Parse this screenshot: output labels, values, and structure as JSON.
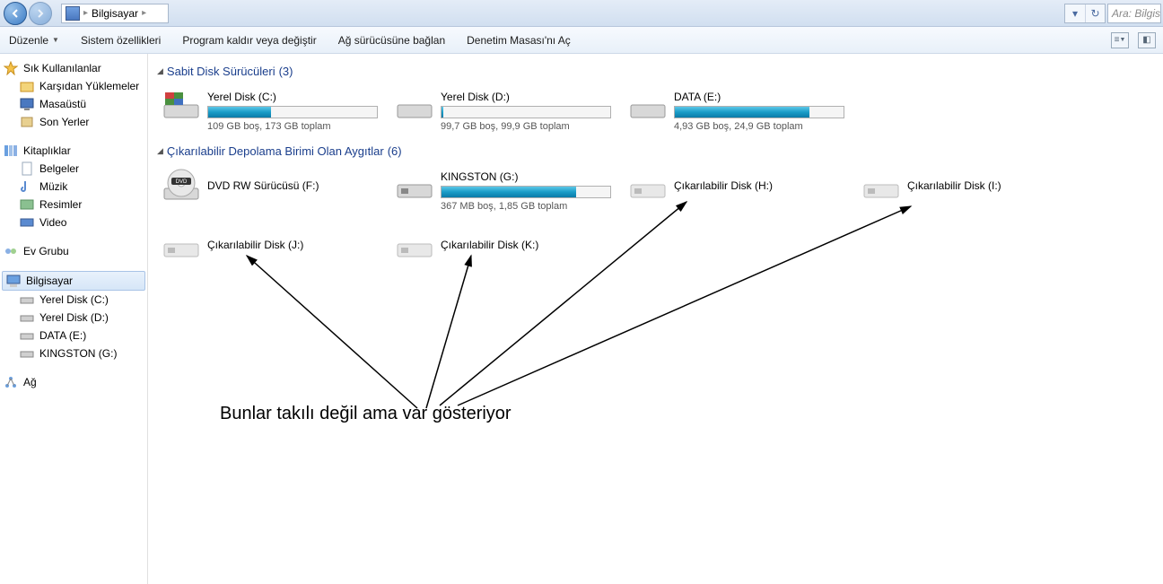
{
  "breadcrumb": {
    "location": "Bilgisayar"
  },
  "search": {
    "placeholder": "Ara: Bilgis"
  },
  "toolbar": {
    "organize": "Düzenle",
    "system_props": "Sistem özellikleri",
    "uninstall": "Program kaldır veya değiştir",
    "map_drive": "Ağ sürücüsüne bağlan",
    "control_panel": "Denetim Masası'nı Aç"
  },
  "sidebar": {
    "favorites": {
      "title": "Sık Kullanılanlar",
      "items": [
        "Karşıdan Yüklemeler",
        "Masaüstü",
        "Son Yerler"
      ]
    },
    "libraries": {
      "title": "Kitaplıklar",
      "items": [
        "Belgeler",
        "Müzik",
        "Resimler",
        "Video"
      ]
    },
    "homegroup": {
      "title": "Ev Grubu"
    },
    "computer": {
      "title": "Bilgisayar",
      "items": [
        "Yerel Disk (C:)",
        "Yerel Disk (D:)",
        "DATA (E:)",
        "KINGSTON (G:)"
      ]
    },
    "network": {
      "title": "Ağ"
    }
  },
  "sections": {
    "hdd": {
      "title": "Sabit Disk Sürücüleri",
      "count": "(3)"
    },
    "removable": {
      "title": "Çıkarılabilir Depolama Birimi Olan Aygıtlar",
      "count": "(6)"
    }
  },
  "drives": {
    "c": {
      "name": "Yerel Disk (C:)",
      "stats": "109 GB boş, 173 GB toplam",
      "fill": 37
    },
    "d": {
      "name": "Yerel Disk (D:)",
      "stats": "99,7 GB boş, 99,9 GB toplam",
      "fill": 1
    },
    "e": {
      "name": "DATA (E:)",
      "stats": "4,93 GB boş, 24,9 GB toplam",
      "fill": 80
    },
    "f": {
      "name": "DVD RW Sürücüsü (F:)"
    },
    "g": {
      "name": "KINGSTON (G:)",
      "stats": "367 MB boş, 1,85 GB toplam",
      "fill": 80
    },
    "h": {
      "name": "Çıkarılabilir Disk (H:)"
    },
    "i": {
      "name": "Çıkarılabilir Disk (I:)"
    },
    "j": {
      "name": "Çıkarılabilir Disk (J:)"
    },
    "k": {
      "name": "Çıkarılabilir Disk (K:)"
    }
  },
  "annotation": "Bunlar takılı değil ama var gösteriyor"
}
